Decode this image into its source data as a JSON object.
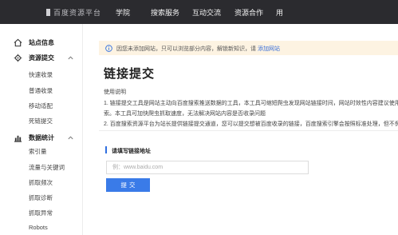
{
  "topbar": {
    "brand": "百度资源平台",
    "nav": [
      {
        "label": "学院"
      },
      {
        "label": "搜索服务"
      },
      {
        "label": "互动交流"
      },
      {
        "label": "资源合作"
      },
      {
        "label": "用"
      }
    ]
  },
  "sidebar": {
    "site_info": {
      "label": "站点信息",
      "icon": "home-icon"
    },
    "resource_submit": {
      "label": "资源提交",
      "icon": "settings-icon",
      "expanded": true,
      "items": [
        {
          "label": "快速收录"
        },
        {
          "label": "普通收录"
        },
        {
          "label": "移动适配"
        },
        {
          "label": "死链提交"
        }
      ]
    },
    "data_stats": {
      "label": "数据统计",
      "icon": "chart-icon",
      "expanded": true,
      "items": [
        {
          "label": "索引量"
        },
        {
          "label": "流量与关键词"
        },
        {
          "label": "抓取频次"
        },
        {
          "label": "抓取诊断"
        },
        {
          "label": "抓取异常"
        },
        {
          "label": "Robots"
        }
      ]
    }
  },
  "notice": {
    "text": "因您未添加网站，只可以浏览部分内容，解锁新知识，请",
    "link": "添加网站"
  },
  "main": {
    "title": "链接提交",
    "description_title": "使用说明",
    "description_lines": [
      "1. 链接提交工具是网站主动向百度搜索推送数据的工具，本工具可缩短爬虫发现网站链接时间，网站时效性内容建议使用链接",
      "索。本工具可加快爬虫抓取速度，无法解决网站内容是否收录问题",
      "2. 百度搜索资源平台为站长提供链接提交通道，您可以提交想被百度收录的链接，百度搜索引擎会按照标准处理，但不保证一"
    ],
    "section_title": "请填写链接地址",
    "input_placeholder": "例：www.baidu.com",
    "submit_label": "提交"
  },
  "colors": {
    "topbar": "#2b2b2f",
    "accent": "#3a7be8",
    "notice_bg": "#fdf3e2",
    "link": "#3a6fd8"
  }
}
